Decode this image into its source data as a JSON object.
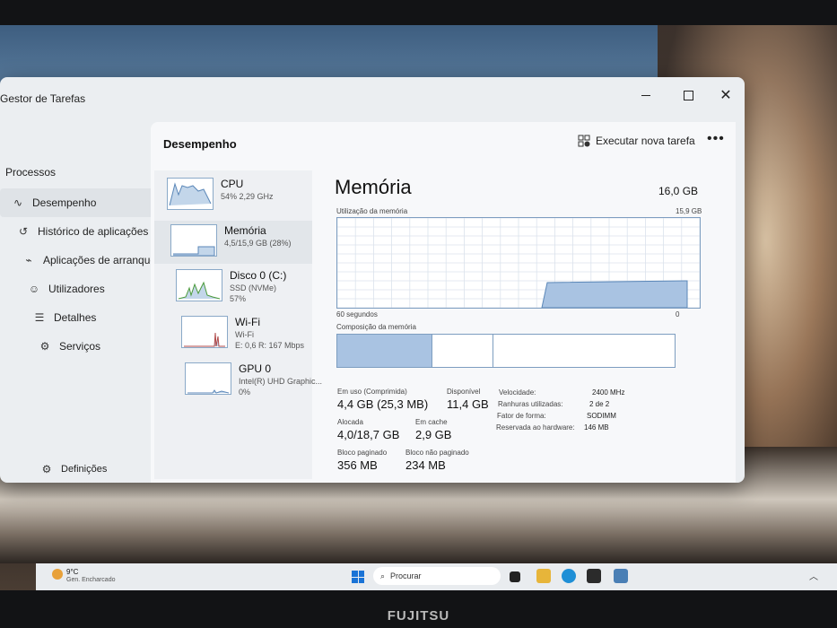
{
  "app_title": "Gestor de Tarefas",
  "brand": "FUJITSU",
  "window_controls": {
    "minimize": "",
    "maximize": "",
    "close": "✕"
  },
  "nav": [
    {
      "label": "Processos",
      "icon": "grid-icon"
    },
    {
      "label": "Desempenho",
      "icon": "pulse-icon",
      "active": true
    },
    {
      "label": "Histórico de aplicações",
      "icon": "history-icon"
    },
    {
      "label": "Aplicações de arranque",
      "icon": "startup-icon"
    },
    {
      "label": "Utilizadores",
      "icon": "users-icon"
    },
    {
      "label": "Detalhes",
      "icon": "list-icon"
    },
    {
      "label": "Serviços",
      "icon": "services-icon"
    }
  ],
  "settings_label": "Definições",
  "panel": {
    "title": "Desempenho",
    "new_task_label": "Executar nova tarefa",
    "more_label": "•••"
  },
  "devices": [
    {
      "name": "CPU",
      "sub1": "54% 2,29 GHz",
      "sub2": ""
    },
    {
      "name": "Memória",
      "sub1": "4,5/15,9 GB (28%)",
      "sub2": "",
      "selected": true
    },
    {
      "name": "Disco 0 (C:)",
      "sub1": "SSD (NVMe)",
      "sub2": "57%"
    },
    {
      "name": "Wi-Fi",
      "sub1": "Wi-Fi",
      "sub2": "E: 0,6 R: 167 Mbps"
    },
    {
      "name": "GPU 0",
      "sub1": "Intel(R) UHD Graphic...",
      "sub2": "0%"
    }
  ],
  "memory": {
    "title": "Memória",
    "total": "16,0 GB",
    "usage_label": "Utilização da memória",
    "usage_max": "15,9 GB",
    "time_left": "60 segundos",
    "time_right": "0",
    "composition_label": "Composição da memória",
    "usage_fraction_recent": 0.28,
    "composition_fractions": [
      0.28,
      0.18,
      0.54
    ],
    "stats": {
      "in_use_label": "Em uso (Comprimida)",
      "in_use": "4,4 GB (25,3 MB)",
      "available_label": "Disponível",
      "available": "11,4 GB",
      "committed_label": "Alocada",
      "committed": "4,0/18,7 GB",
      "cached_label": "Em cache",
      "cached": "2,9 GB",
      "paged_label": "Bloco paginado",
      "paged": "356 MB",
      "nonpaged_label": "Bloco não paginado",
      "nonpaged": "234 MB"
    },
    "props": [
      {
        "label": "Velocidade:",
        "value": "2400 MHz"
      },
      {
        "label": "Ranhuras utilizadas:",
        "value": "2 de 2"
      },
      {
        "label": "Fator de forma:",
        "value": "SODIMM"
      },
      {
        "label": "Reservada ao hardware:",
        "value": "146 MB"
      }
    ]
  },
  "taskbar": {
    "weather_temp": "9°C",
    "weather_desc": "Gen. Encharcado",
    "search_placeholder": "Procurar"
  },
  "colors": {
    "graph_fill": "#a9c3e2",
    "graph_stroke": "#5b87b8",
    "accent": "#1a73d6"
  }
}
